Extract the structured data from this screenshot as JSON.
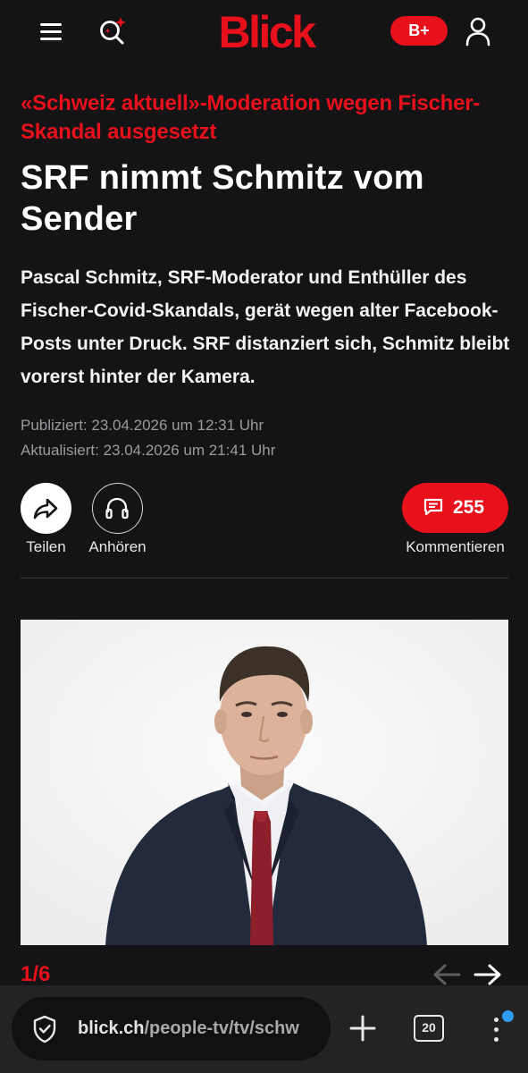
{
  "header": {
    "logo": "Blick",
    "bplus_label": "B+",
    "icons": [
      "menu-icon",
      "search-sparkle-icon",
      "user-icon"
    ],
    "brand_color": "#e8101a"
  },
  "article": {
    "kicker": "«Schweiz aktuell»-Moderation wegen Fischer-Skandal ausgesetzt",
    "headline": "SRF nimmt Schmitz vom Sender",
    "lead": "Pascal Schmitz, SRF-Moderator und Enthüller des Fischer-Covid-Skandals, gerät wegen alter Facebook-Posts unter Druck. SRF distanziert sich, Schmitz bleibt vorerst hinter der Kamera.",
    "published": "Publiziert: 23.04.2026 um 12:31 Uhr",
    "updated": "Aktualisiert: 23.04.2026 um 21:41 Uhr"
  },
  "actions": {
    "share_label": "Teilen",
    "listen_label": "Anhören",
    "comments_count": "255",
    "comments_label": "Kommentieren",
    "icons": [
      "share-icon",
      "headphones-icon",
      "comment-icon"
    ]
  },
  "gallery": {
    "counter": "1/6",
    "icons": [
      "arrow-left-icon",
      "arrow-right-icon"
    ]
  },
  "browser": {
    "url_domain": "blick.ch",
    "url_path": "/people-tv/tv/schw",
    "tab_count": "20",
    "icons": [
      "shield-check-icon",
      "plus-icon",
      "more-vertical-icon"
    ],
    "notification_color": "#2c9cf3"
  }
}
